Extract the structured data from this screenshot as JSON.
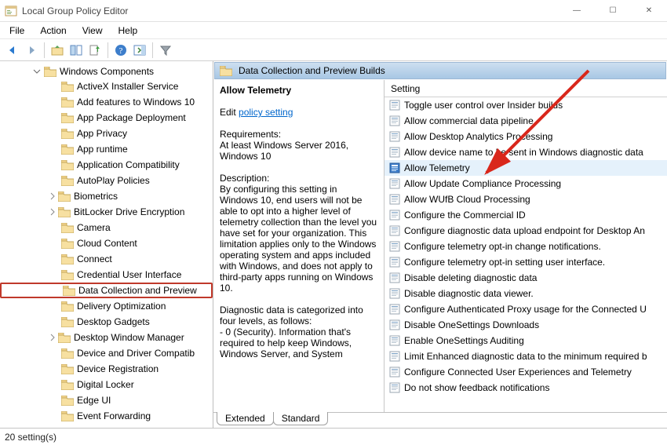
{
  "title": "Local Group Policy Editor",
  "window_controls": {
    "minimize": "—",
    "maximize": "☐",
    "close": "✕"
  },
  "menu": [
    "File",
    "Action",
    "View",
    "Help"
  ],
  "toolbar": [
    "back",
    "forward",
    "up",
    "show-hide-tree",
    "export",
    "properties",
    "help",
    "show-hide-action",
    "filter"
  ],
  "tree": {
    "root_label": "Windows Components",
    "items": [
      {
        "label": "ActiveX Installer Service",
        "twist": false
      },
      {
        "label": "Add features to Windows 10",
        "twist": false
      },
      {
        "label": "App Package Deployment",
        "twist": false
      },
      {
        "label": "App Privacy",
        "twist": false
      },
      {
        "label": "App runtime",
        "twist": false
      },
      {
        "label": "Application Compatibility",
        "twist": false
      },
      {
        "label": "AutoPlay Policies",
        "twist": false
      },
      {
        "label": "Biometrics",
        "twist": true
      },
      {
        "label": "BitLocker Drive Encryption",
        "twist": true
      },
      {
        "label": "Camera",
        "twist": false
      },
      {
        "label": "Cloud Content",
        "twist": false
      },
      {
        "label": "Connect",
        "twist": false
      },
      {
        "label": "Credential User Interface",
        "twist": false
      },
      {
        "label": "Data Collection and Preview",
        "twist": false,
        "highlighted": true
      },
      {
        "label": "Delivery Optimization",
        "twist": false
      },
      {
        "label": "Desktop Gadgets",
        "twist": false
      },
      {
        "label": "Desktop Window Manager",
        "twist": true
      },
      {
        "label": "Device and Driver Compatib",
        "twist": false
      },
      {
        "label": "Device Registration",
        "twist": false
      },
      {
        "label": "Digital Locker",
        "twist": false
      },
      {
        "label": "Edge UI",
        "twist": false
      },
      {
        "label": "Event Forwarding",
        "twist": false
      }
    ]
  },
  "content_header": "Data Collection and Preview Builds",
  "detail": {
    "title": "Allow Telemetry",
    "edit_prefix": "Edit ",
    "edit_link": "policy setting ",
    "req_label": "Requirements:",
    "req_text": "At least Windows Server 2016, Windows 10",
    "desc_label": "Description:",
    "desc_text": "By configuring this setting in Windows 10, end users will not be able to opt into a higher level of telemetry collection than the level you have set for your organization.  This limitation applies only to the Windows operating system and apps included with Windows, and does not apply to third-party apps running on Windows 10.",
    "desc_text2": "Diagnostic data is categorized into four levels, as follows:",
    "desc_text3": "  - 0 (Security). Information that's required to help keep Windows, Windows Server, and System"
  },
  "list": {
    "column": "Setting",
    "rows": [
      {
        "label": "Toggle user control over Insider builds",
        "selected": false
      },
      {
        "label": "Allow commercial data pipeline",
        "selected": false
      },
      {
        "label": "Allow Desktop Analytics Processing",
        "selected": false
      },
      {
        "label": "Allow device name to be sent in Windows diagnostic data",
        "selected": false
      },
      {
        "label": "Allow Telemetry",
        "selected": true
      },
      {
        "label": "Allow Update Compliance Processing",
        "selected": false
      },
      {
        "label": "Allow WUfB Cloud Processing",
        "selected": false
      },
      {
        "label": "Configure the Commercial ID",
        "selected": false
      },
      {
        "label": "Configure diagnostic data upload endpoint for Desktop An",
        "selected": false
      },
      {
        "label": "Configure telemetry opt-in change notifications.",
        "selected": false
      },
      {
        "label": "Configure telemetry opt-in setting user interface.",
        "selected": false
      },
      {
        "label": "Disable deleting diagnostic data",
        "selected": false
      },
      {
        "label": "Disable diagnostic data viewer.",
        "selected": false
      },
      {
        "label": "Configure Authenticated Proxy usage for the Connected U",
        "selected": false
      },
      {
        "label": "Disable OneSettings Downloads",
        "selected": false
      },
      {
        "label": "Enable OneSettings Auditing",
        "selected": false
      },
      {
        "label": "Limit Enhanced diagnostic data to the minimum required b",
        "selected": false
      },
      {
        "label": "Configure Connected User Experiences and Telemetry",
        "selected": false
      },
      {
        "label": "Do not show feedback notifications",
        "selected": false
      }
    ]
  },
  "tabs": [
    "Extended",
    "Standard"
  ],
  "status": "20 setting(s)"
}
